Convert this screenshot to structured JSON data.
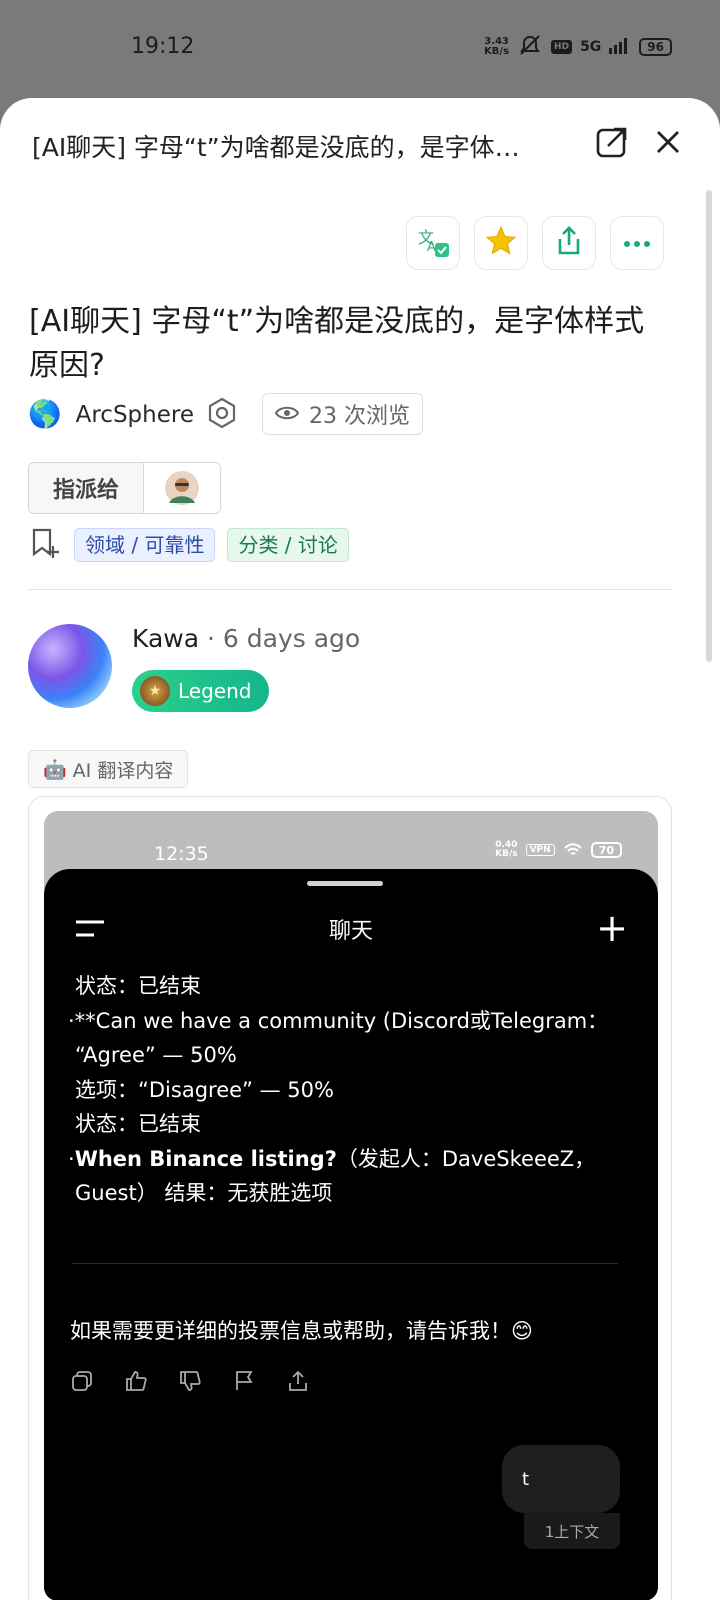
{
  "status_bar": {
    "time": "19:12",
    "net_speed_value": "3.43",
    "net_speed_unit": "KB/s",
    "hd": "HD",
    "network": "5G",
    "battery": "96"
  },
  "sheet": {
    "title": "[AI聊天] 字母“t”为啥都是没底的，是字体…",
    "open_external_icon": "open-external-icon",
    "close_icon": "close-icon"
  },
  "actions": {
    "translate_icon": "translate-icon",
    "bookmark_icon": "star-icon",
    "share_icon": "share-icon",
    "more_icon": "more-icon"
  },
  "post": {
    "title": "[AI聊天] 字母“t”为啥都是没底的，是字体样式原因?",
    "category_icon": "globe-icon",
    "author": "ArcSphere",
    "views": "23 次浏览",
    "assign_label": "指派给",
    "tags": [
      "领域 / 可靠性",
      "分类 / 讨论"
    ]
  },
  "reply": {
    "username": "Kawa",
    "separator": "·",
    "time_ago": "6 days ago",
    "badge": "Legend",
    "ai_chip": "AI 翻译内容",
    "ai_chip_icon": "🤖"
  },
  "embedded": {
    "status_time": "12:35",
    "status_speed_value": "0.40",
    "status_speed_unit": "KB/s",
    "status_vpn": "VPN",
    "status_battery": "70",
    "title": "聊天",
    "lines": [
      "状态：已结束",
      "·**Can we have a community (Discord或Telegram：",
      "“Agree” — 50%",
      "选项：“Disagree” — 50%",
      "状态：已结束"
    ],
    "line_bold_lead": "When Binance listing?",
    "line_bold_prefix": "·",
    "line_bold_rest": "（发起人：DaveSkeeeZ，",
    "line_last": "Guest） 结果：无获胜选项",
    "message": "如果需要更详细的投票信息或帮助，请告诉我！😊",
    "bubble_text": "t",
    "context_label": "1上下文"
  }
}
